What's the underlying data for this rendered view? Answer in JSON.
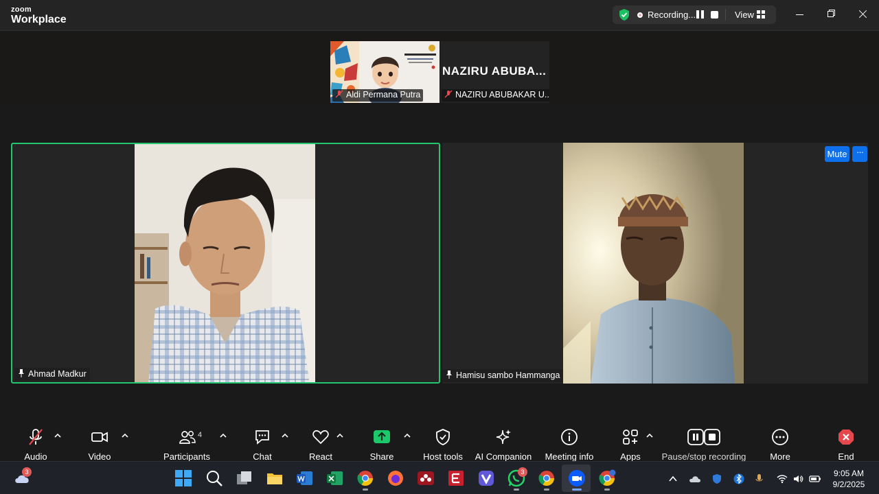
{
  "app": {
    "brand_top": "zoom",
    "brand_bottom": "Workplace"
  },
  "titlebar": {
    "recording_label": "Recording...",
    "view_label": "View"
  },
  "gallery": [
    {
      "name": "Aldi Permana Putra"
    },
    {
      "big_name": "NAZIRU  ABUBA...",
      "name": "NAZIRU ABUBAKAR U..."
    }
  ],
  "tiles": [
    {
      "name": "Ahmad Madkur",
      "active_speaker": true
    },
    {
      "name": "Hamisu sambo Hammanga"
    }
  ],
  "tile_controls": {
    "mute_label": "Mute",
    "more_label": "···"
  },
  "toolbar": {
    "audio": "Audio",
    "video": "Video",
    "participants": "Participants",
    "participants_count": "4",
    "chat": "Chat",
    "react": "React",
    "share": "Share",
    "host_tools": "Host tools",
    "ai_companion": "AI Companion",
    "meeting_info": "Meeting info",
    "apps": "Apps",
    "pause_stop": "Pause/stop recording",
    "more": "More",
    "end": "End"
  },
  "taskbar": {
    "weather_badge": "3",
    "whatsapp_badge": "3",
    "time": "9:05 AM",
    "date": "9/2/2025"
  },
  "colors": {
    "accent_blue": "#0e71eb",
    "active_green": "#22c870",
    "share_green": "#1cc86a",
    "end_red": "#e5484d"
  }
}
